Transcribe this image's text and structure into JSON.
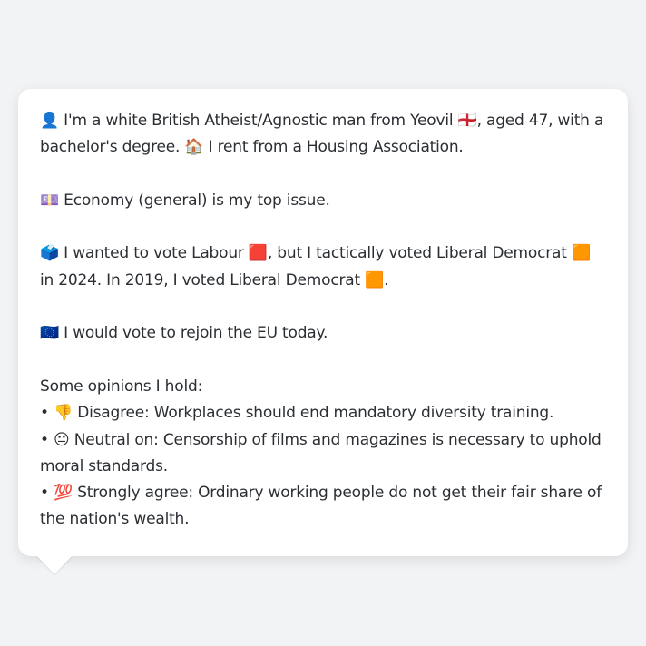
{
  "profile": {
    "identity_emoji": "👤",
    "identity_text_1": " I'm a white British Atheist/Agnostic man from Yeovil ",
    "flag_england": "🏴󠁧󠁢󠁥󠁮󠁧󠁿",
    "identity_text_2": ", aged 47, with a bachelor's degree. ",
    "home_emoji": "🏠",
    "housing_text": " I rent from a Housing Association."
  },
  "issue": {
    "emoji": "💷",
    "text": " Economy (general) is my top issue."
  },
  "vote": {
    "emoji": "🗳️",
    "text_1": " I wanted to vote Labour ",
    "labour_square": "🟥",
    "text_2": ", but I tactically voted Liberal Democrat ",
    "libdem_square_1": "🟧",
    "text_3": " in 2024. In 2019, I voted Liberal Democrat ",
    "libdem_square_2": "🟧",
    "text_4": "."
  },
  "eu": {
    "emoji": "🇪🇺",
    "text": " I would vote to rejoin the EU today."
  },
  "opinions": {
    "heading": "Some opinions I hold:",
    "items": [
      {
        "bullet": "• ",
        "emoji": "👎",
        "text": " Disagree: Workplaces should end mandatory diversity training."
      },
      {
        "bullet": "• ",
        "emoji": "😐",
        "text": " Neutral on: Censorship of films and magazines is necessary to uphold moral standards."
      },
      {
        "bullet": "• ",
        "emoji": "💯",
        "text": " Strongly agree: Ordinary working people do not get their fair share of the nation's wealth."
      }
    ]
  }
}
